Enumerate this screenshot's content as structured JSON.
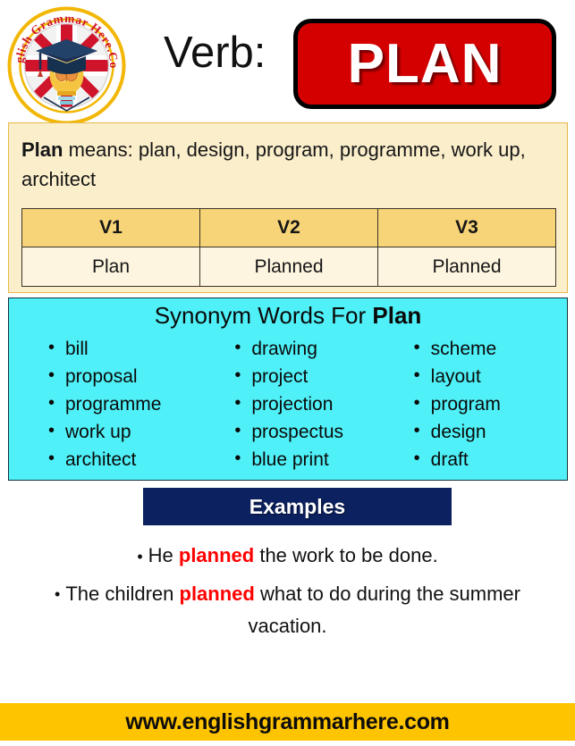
{
  "header": {
    "logo_alt": "English Grammar Here.Com",
    "logo_text_top": "English Grammar",
    "logo_text_bottom": "Here.Com",
    "verb_label": "Verb:",
    "verb_word": "PLAN",
    "badge_color": "#d40000"
  },
  "definition": {
    "word": "Plan",
    "means_prefix": " means: ",
    "meanings": "plan, design, program, programme, work up, architect",
    "panel_color": "#fbeecb"
  },
  "verb_table": {
    "headers": [
      "V1",
      "V2",
      "V3"
    ],
    "row": [
      "Plan",
      "Planned",
      "Planned"
    ],
    "header_color": "#f7d477",
    "cell_color": "#fdf5e0"
  },
  "synonyms": {
    "title_prefix": "Synonym Words For ",
    "title_word": "Plan",
    "panel_color": "#4ff0f7",
    "columns": [
      [
        "bill",
        "proposal",
        "programme",
        "work up",
        "architect"
      ],
      [
        "drawing",
        "project",
        "projection",
        "prospectus",
        "blue print"
      ],
      [
        "scheme",
        "layout",
        "program",
        "design",
        "draft"
      ]
    ]
  },
  "examples": {
    "bar_label": "Examples",
    "bar_color": "#0c2260",
    "highlight_color": "#ff0000",
    "items": [
      {
        "before": "He ",
        "highlight": "planned",
        "after": " the work to be done."
      },
      {
        "before": "The children ",
        "highlight": "planned",
        "after": " what to do during the summer vacation."
      }
    ]
  },
  "footer": {
    "url": "www.englishgrammarhere.com",
    "bar_color": "#ffc400"
  }
}
